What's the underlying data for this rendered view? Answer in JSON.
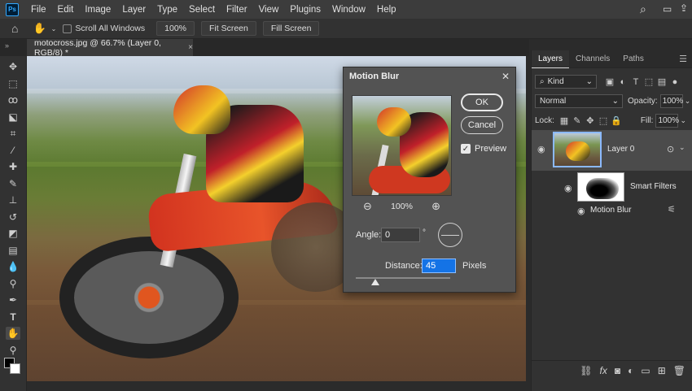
{
  "app": {
    "logo": "Ps"
  },
  "menu": [
    "File",
    "Edit",
    "Image",
    "Layer",
    "Type",
    "Select",
    "Filter",
    "View",
    "Plugins",
    "Window",
    "Help"
  ],
  "options_bar": {
    "scroll_all_windows": "Scroll All Windows",
    "zoom": "100%",
    "fit_screen": "Fit Screen",
    "fill_screen": "Fill Screen"
  },
  "document_tab": {
    "title": "motocross.jpg @ 66.7% (Layer 0, RGB/8) *",
    "close": "×"
  },
  "dialog": {
    "title": "Motion Blur",
    "ok": "OK",
    "cancel": "Cancel",
    "preview_label": "Preview",
    "preview_checked": true,
    "zoom_level": "100%",
    "angle_label": "Angle:",
    "angle_value": "0",
    "angle_unit": "°",
    "distance_label": "Distance:",
    "distance_value": "45",
    "distance_unit": "Pixels",
    "distance_slider_fraction": 0.21
  },
  "panel": {
    "tabs": [
      "Layers",
      "Channels",
      "Paths"
    ],
    "active_tab": "Layers",
    "filter_kind": "Kind",
    "blend_mode": "Normal",
    "opacity_label": "Opacity:",
    "opacity_value": "100%",
    "lock_label": "Lock:",
    "fill_label": "Fill:",
    "fill_value": "100%",
    "layers": [
      {
        "name": "Layer 0",
        "selected": true
      },
      {
        "name": "Smart Filters"
      },
      {
        "name": "Motion Blur"
      }
    ]
  },
  "colors": {
    "accent": "#31a8ff",
    "selection": "#1473e6",
    "panel_bg": "#323232",
    "dialog_bg": "#535353"
  },
  "icons": {
    "toolbar": [
      "move-icon",
      "marquee-icon",
      "lasso-icon",
      "object-select-icon",
      "crop-icon",
      "eyedropper-icon",
      "healing-brush-icon",
      "brush-icon",
      "clone-stamp-icon",
      "history-brush-icon",
      "eraser-icon",
      "gradient-icon",
      "blur-icon",
      "dodge-icon",
      "pen-icon",
      "type-icon",
      "hand-icon",
      "zoom-icon",
      "more-tools-icon"
    ]
  }
}
